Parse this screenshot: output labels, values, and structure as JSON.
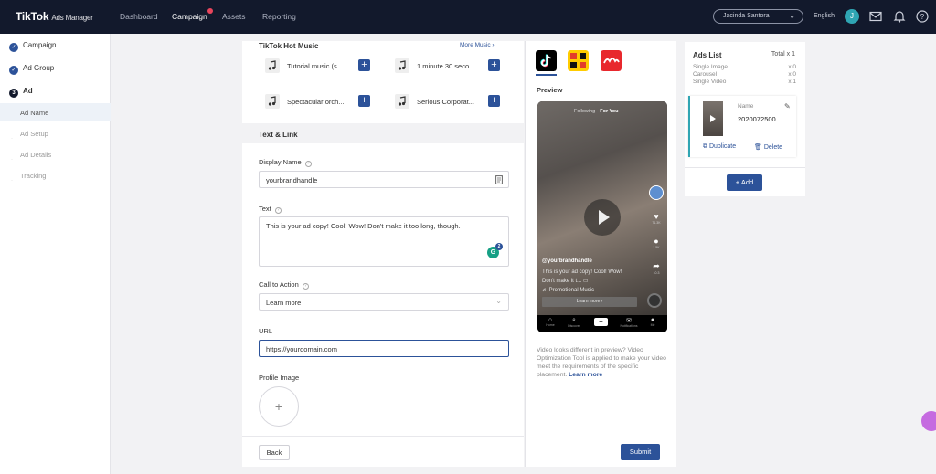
{
  "header": {
    "brand": "TikTok",
    "brand_sub": "Ads Manager",
    "nav": [
      "Dashboard",
      "Campaign",
      "Assets",
      "Reporting"
    ],
    "account_name": "Jacinda Santora",
    "language": "English",
    "avatar_initial": "J"
  },
  "sidebar": {
    "steps": [
      {
        "label": "Campaign",
        "state": "done"
      },
      {
        "label": "Ad Group",
        "state": "done"
      },
      {
        "label": "Ad",
        "state": "current",
        "number": "3"
      }
    ],
    "substeps": [
      "Ad Name",
      "Ad Setup",
      "Ad Details",
      "Tracking"
    ]
  },
  "music": {
    "title": "TikTok Hot Music",
    "more": "More Music",
    "tracks": [
      "Tutorial music (s...",
      "1 minute 30 seco...",
      "Spectacular orch...",
      "Serious Corporat..."
    ]
  },
  "text_link": {
    "section": "Text & Link",
    "display_name_label": "Display Name",
    "display_name_value": "yourbrandhandle",
    "text_label": "Text",
    "text_value": "This is your ad copy! Cool! Wow! Don't make it too long, though.",
    "grammarly_count": "2",
    "cta_label": "Call to Action",
    "cta_value": "Learn more",
    "url_label": "URL",
    "url_value": "https://yourdomain.com",
    "profile_label": "Profile Image"
  },
  "buttons": {
    "back": "Back",
    "submit": "Submit",
    "add": "+ Add"
  },
  "preview": {
    "label": "Preview",
    "tab_following": "Following",
    "tab_foryou": "For You",
    "handle": "@yourbrandhandle",
    "copy_line1": "This is your ad copy! Cool! Wow!",
    "copy_line2": "Don't make it t... ▭",
    "music": "♬ Promotional Music",
    "cta": "Learn more ›",
    "likes": "71.3K",
    "comments": "1.5K",
    "shares": "10.3",
    "nav": [
      "Home",
      "Discover",
      "Notifications",
      "Me"
    ],
    "note": "Video looks different in preview? Video Optimization Tool is applied to make your video meet the requirements of the specific placement.",
    "note_link": "Learn more"
  },
  "ads_list": {
    "title": "Ads List",
    "total": "Total x 1",
    "rows": [
      {
        "label": "Single Image",
        "value": "x 0"
      },
      {
        "label": "Carousel",
        "value": "x 0"
      },
      {
        "label": "Single Video",
        "value": "x 1"
      }
    ],
    "name_label": "Name",
    "name_value": "2020072500",
    "duplicate": "Duplicate",
    "delete": "Delete"
  },
  "colors": {
    "accent": "#2c5299",
    "topbar": "#12192c",
    "teal": "#2fa5b3"
  }
}
